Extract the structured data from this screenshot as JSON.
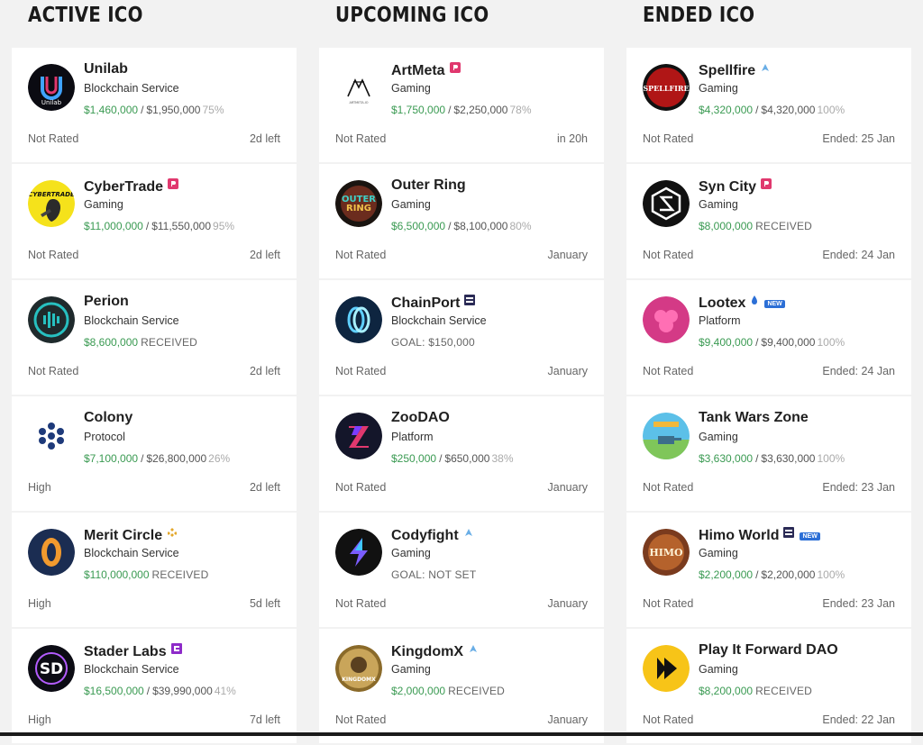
{
  "columns": [
    {
      "title": "ACTIVE ICO",
      "cards": [
        {
          "name": "Unilab",
          "category": "Blockchain Service",
          "raised": "$1,460,000",
          "goal": "$1,950,000",
          "percent": "75%",
          "rating": "Not Rated",
          "timing": "2d left",
          "logo": "unilab-logo"
        },
        {
          "name": "CyberTrade",
          "category": "Gaming",
          "raised": "$11,000,000",
          "goal": "$11,550,000",
          "percent": "95%",
          "rating": "Not Rated",
          "timing": "2d left",
          "logo": "cybertrade-logo",
          "badge": "launchpad-pink-icon"
        },
        {
          "name": "Perion",
          "category": "Blockchain Service",
          "raised": "$8,600,000",
          "received": "RECEIVED",
          "rating": "Not Rated",
          "timing": "2d left",
          "logo": "perion-logo"
        },
        {
          "name": "Colony",
          "category": "Protocol",
          "raised": "$7,100,000",
          "goal": "$26,800,000",
          "percent": "26%",
          "rating": "High",
          "timing": "2d left",
          "logo": "colony-logo"
        },
        {
          "name": "Merit Circle",
          "category": "Blockchain Service",
          "raised": "$110,000,000",
          "received": "RECEIVED",
          "rating": "High",
          "timing": "5d left",
          "logo": "merit-circle-logo",
          "badge": "bnb-chain-icon"
        },
        {
          "name": "Stader Labs",
          "category": "Blockchain Service",
          "raised": "$16,500,000",
          "goal": "$39,990,000",
          "percent": "41%",
          "rating": "High",
          "timing": "7d left",
          "logo": "stader-labs-logo",
          "badge": "platform-purple-icon"
        }
      ]
    },
    {
      "title": "UPCOMING ICO",
      "cards": [
        {
          "name": "ArtMeta",
          "category": "Gaming",
          "raised": "$1,750,000",
          "goal": "$2,250,000",
          "percent": "78%",
          "rating": "Not Rated",
          "timing": "in 20h",
          "logo": "artmeta-logo",
          "badge": "launchpad-pink-icon"
        },
        {
          "name": "Outer Ring",
          "category": "Gaming",
          "raised": "$6,500,000",
          "goal": "$8,100,000",
          "percent": "80%",
          "rating": "Not Rated",
          "timing": "January",
          "logo": "outer-ring-logo"
        },
        {
          "name": "ChainPort",
          "category": "Blockchain Service",
          "goal_text": "GOAL: $150,000",
          "rating": "Not Rated",
          "timing": "January",
          "logo": "chainport-logo",
          "badge": "platform-dark-icon"
        },
        {
          "name": "ZooDAO",
          "category": "Platform",
          "raised": "$250,000",
          "goal": "$650,000",
          "percent": "38%",
          "rating": "Not Rated",
          "timing": "January",
          "logo": "zoodao-logo"
        },
        {
          "name": "Codyfight",
          "category": "Gaming",
          "goal_text": "GOAL: NOT SET",
          "rating": "Not Rated",
          "timing": "January",
          "logo": "codyfight-logo",
          "badge": "launchpad-blue-icon"
        },
        {
          "name": "KingdomX",
          "category": "Gaming",
          "raised": "$2,000,000",
          "received": "RECEIVED",
          "rating": "Not Rated",
          "timing": "January",
          "logo": "kingdomx-logo",
          "badge": "launchpad-blue-icon"
        }
      ]
    },
    {
      "title": "ENDED ICO",
      "cards": [
        {
          "name": "Spellfire",
          "category": "Gaming",
          "raised": "$4,320,000",
          "goal": "$4,320,000",
          "percent": "100%",
          "rating": "Not Rated",
          "timing": "Ended: 25 Jan",
          "logo": "spellfire-logo",
          "badge": "launchpad-blue-icon"
        },
        {
          "name": "Syn City",
          "category": "Gaming",
          "raised": "$8,000,000",
          "received": "RECEIVED",
          "rating": "Not Rated",
          "timing": "Ended: 24 Jan",
          "logo": "syn-city-logo",
          "badge": "launchpad-pink-icon"
        },
        {
          "name": "Lootex",
          "category": "Platform",
          "raised": "$9,400,000",
          "goal": "$9,400,000",
          "percent": "100%",
          "rating": "Not Rated",
          "timing": "Ended: 24 Jan",
          "logo": "lootex-logo",
          "badge": "drop-icon",
          "new": "NEW"
        },
        {
          "name": "Tank Wars Zone",
          "category": "Gaming",
          "raised": "$3,630,000",
          "goal": "$3,630,000",
          "percent": "100%",
          "rating": "Not Rated",
          "timing": "Ended: 23 Jan",
          "logo": "tank-wars-zone-logo"
        },
        {
          "name": "Himo World",
          "category": "Gaming",
          "raised": "$2,200,000",
          "goal": "$2,200,000",
          "percent": "100%",
          "rating": "Not Rated",
          "timing": "Ended: 23 Jan",
          "logo": "himo-world-logo",
          "badge": "platform-dark-icon",
          "new": "NEW"
        },
        {
          "name": "Play It Forward DAO",
          "category": "Gaming",
          "raised": "$8,200,000",
          "received": "RECEIVED",
          "rating": "Not Rated",
          "timing": "Ended: 22 Jan",
          "logo": "play-it-forward-dao-logo"
        }
      ]
    }
  ],
  "colors": {
    "raised": "#3a9a52",
    "badge_pink": "#e0386e",
    "badge_blue": "#6aaee6",
    "badge_purple": "#8e2bc9",
    "badge_gold": "#e3a72b",
    "new_badge": "#2c6fd6"
  }
}
